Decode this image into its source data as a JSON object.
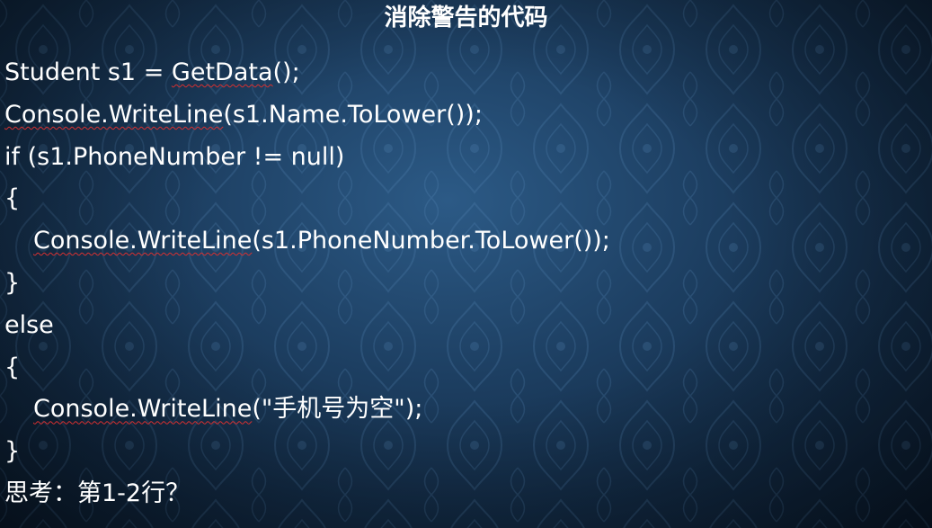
{
  "slide": {
    "title": "消除警告的代码",
    "background_color": "#1d3f62",
    "code_lines": [
      {
        "before": "Student s1 = ",
        "flag": "GetData",
        "after": "();"
      },
      {
        "before": "",
        "flag": "Console.WriteLine",
        "after": "(s1.Name.ToLower());"
      },
      {
        "before": "if (s1.PhoneNumber != null)",
        "flag": "",
        "after": ""
      },
      {
        "before": "{",
        "flag": "",
        "after": ""
      },
      {
        "before": "",
        "flag": "Console.WriteLine",
        "after": "(s1.PhoneNumber.ToLower());"
      },
      {
        "before": "}",
        "flag": "",
        "after": ""
      },
      {
        "before": "else",
        "flag": "",
        "after": ""
      },
      {
        "before": "{",
        "flag": "",
        "after": ""
      },
      {
        "before": "",
        "flag": "Console.WriteLine",
        "after": "(\"手机号为空\");"
      },
      {
        "before": "}",
        "flag": "",
        "after": ""
      }
    ],
    "question": "思考：第1-2行？"
  }
}
